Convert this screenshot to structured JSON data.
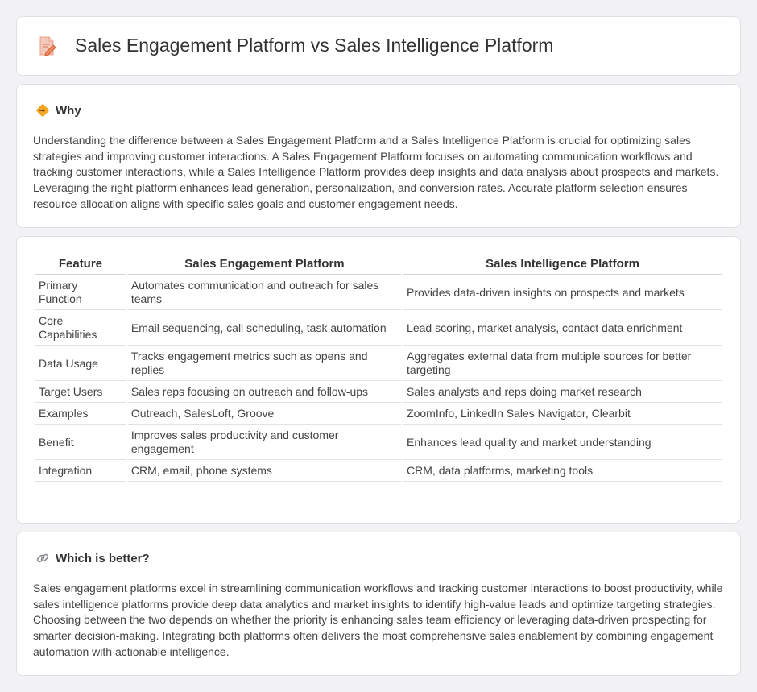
{
  "header": {
    "title": "Sales Engagement Platform vs Sales Intelligence Platform"
  },
  "why": {
    "heading": "Why",
    "text": "Understanding the difference between a Sales Engagement Platform and a Sales Intelligence Platform is crucial for optimizing sales strategies and improving customer interactions. A Sales Engagement Platform focuses on automating communication workflows and tracking customer interactions, while a Sales Intelligence Platform provides deep insights and data analysis about prospects and markets. Leveraging the right platform enhances lead generation, personalization, and conversion rates. Accurate platform selection ensures resource allocation aligns with specific sales goals and customer engagement needs."
  },
  "table": {
    "headers": [
      "Feature",
      "Sales Engagement Platform",
      "Sales Intelligence Platform"
    ],
    "rows": [
      [
        "Primary Function",
        "Automates communication and outreach for sales teams",
        "Provides data-driven insights on prospects and markets"
      ],
      [
        "Core Capabilities",
        "Email sequencing, call scheduling, task automation",
        "Lead scoring, market analysis, contact data enrichment"
      ],
      [
        "Data Usage",
        "Tracks engagement metrics such as opens and replies",
        "Aggregates external data from multiple sources for better targeting"
      ],
      [
        "Target Users",
        "Sales reps focusing on outreach and follow-ups",
        "Sales analysts and reps doing market research"
      ],
      [
        "Examples",
        "Outreach, SalesLoft, Groove",
        "ZoomInfo, LinkedIn Sales Navigator, Clearbit"
      ],
      [
        "Benefit",
        "Improves sales productivity and customer engagement",
        "Enhances lead quality and market understanding"
      ],
      [
        "Integration",
        "CRM, email, phone systems",
        "CRM, data platforms, marketing tools"
      ]
    ]
  },
  "better": {
    "heading": "Which is better?",
    "text": "Sales engagement platforms excel in streamlining communication workflows and tracking customer interactions to boost productivity, while sales intelligence platforms provide deep data analytics and market insights to identify high-value leads and optimize targeting strategies. Choosing between the two depends on whether the priority is enhancing sales team efficiency or leveraging data-driven prospecting for smarter decision-making. Integrating both platforms often delivers the most comprehensive sales enablement by combining engagement automation with actionable intelligence."
  },
  "icons": {
    "title": "document-pencil-icon",
    "why": "diamond-arrow-icon",
    "better": "link-icon"
  },
  "colors": {
    "background": "#f2f2f4",
    "card": "#ffffff",
    "accent_orange": "#f5a623",
    "accent_red": "#e8553f"
  }
}
